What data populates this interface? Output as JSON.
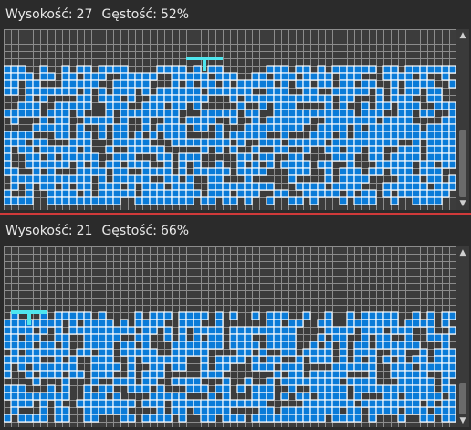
{
  "panels": [
    {
      "height_label": "Wysokość:",
      "height_value": "27",
      "density_label": "Gęstość:",
      "density_value": "52%"
    },
    {
      "height_label": "Wysokość:",
      "height_value": "21",
      "density_label": "Gęstość:",
      "density_value": "66%"
    }
  ],
  "colors": {
    "background": "#2b2b2b",
    "board": "#3c3c3c",
    "grid": "#8c8c8c",
    "pipe": "#0a7bd8",
    "pipe_outline": "#ffffff",
    "highlight": "#4fe6ee",
    "divider": "#d03a3a"
  },
  "icons": {
    "scroll_up": "▲",
    "scroll_down": "▼"
  }
}
